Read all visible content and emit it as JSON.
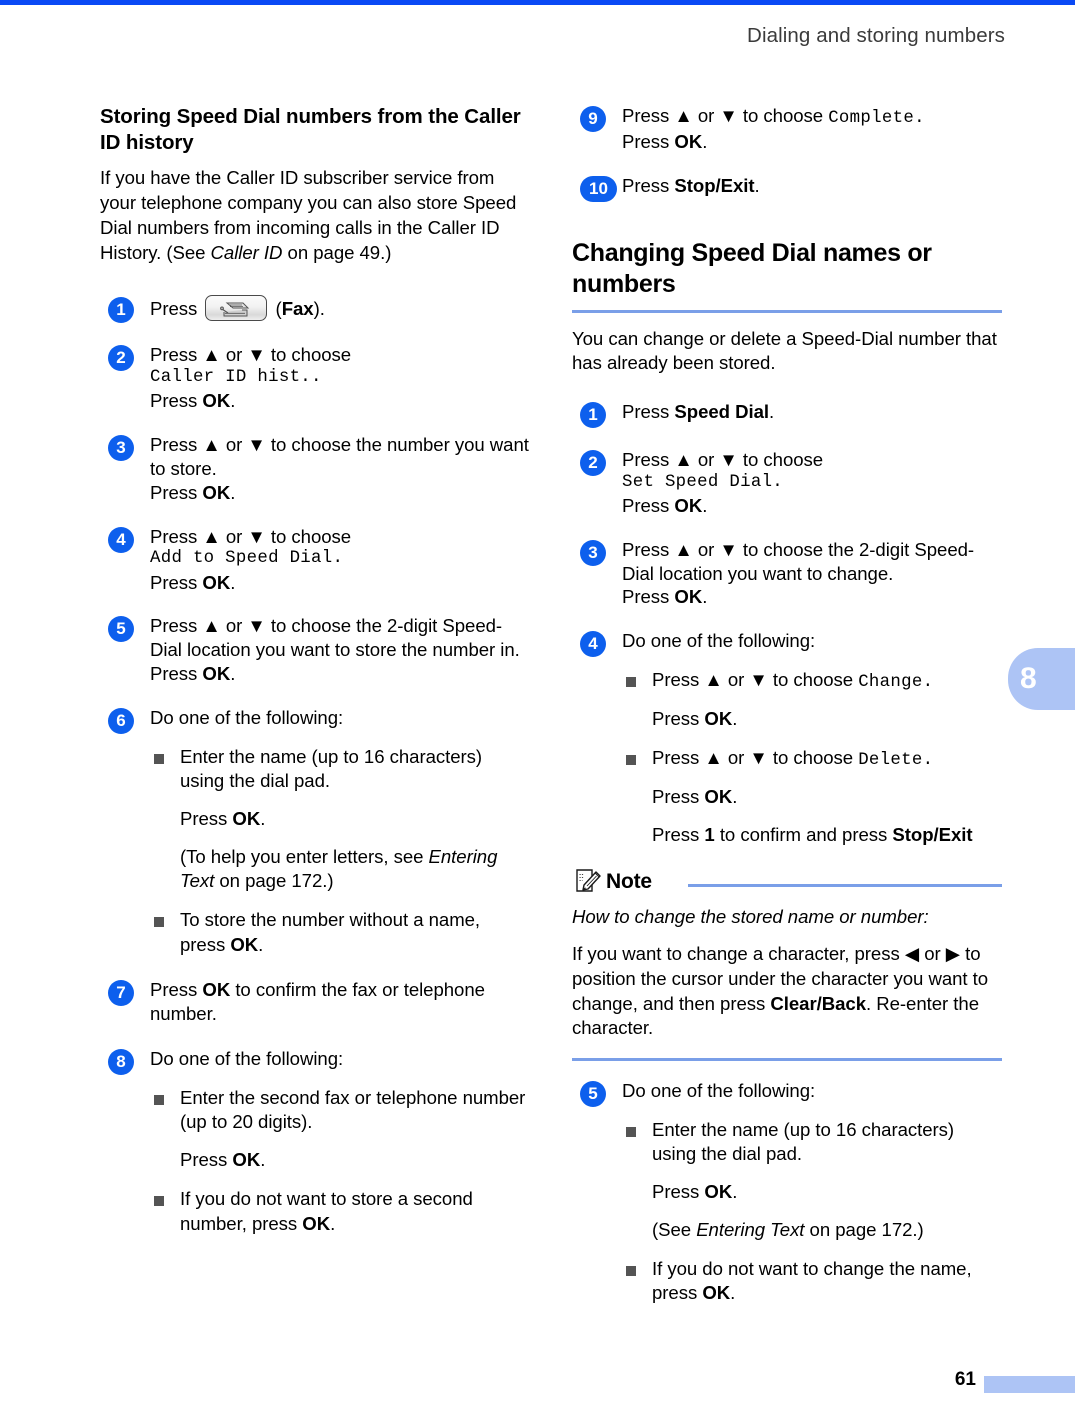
{
  "page": {
    "header_title": "Dialing and storing numbers",
    "chapter_tab": "8",
    "page_number": "61"
  },
  "left_column": {
    "heading": "Storing Speed Dial numbers from the Caller ID history",
    "intro_a": "If you have the Caller ID subscriber service from your telephone company you can also store Speed Dial numbers from incoming calls in the Caller ID History. (See ",
    "intro_italic": "Caller ID",
    "intro_b": " on page 49.)",
    "steps": [
      {
        "num": "1",
        "press": "Press",
        "icon_name": "fax-key-icon",
        "key_label": "Fax",
        "suffix": ")."
      },
      {
        "num": "2",
        "line1": "Press ▲ or ▼ to choose",
        "lcd": "Caller ID hist..",
        "line3_pre": "Press ",
        "line3_key": "OK",
        "line3_post": "."
      },
      {
        "num": "3",
        "line1": "Press ▲ or ▼ to choose the number you want to store.",
        "line3_pre": "Press ",
        "line3_key": "OK",
        "line3_post": "."
      },
      {
        "num": "4",
        "line1": "Press ▲ or ▼ to choose",
        "lcd": "Add to Speed Dial.",
        "line3_pre": "Press ",
        "line3_key": "OK",
        "line3_post": "."
      },
      {
        "num": "5",
        "line1": "Press ▲ or ▼ to choose the 2-digit Speed-Dial location you want to store the number in.",
        "line3_pre": "Press ",
        "line3_key": "OK",
        "line3_post": "."
      },
      {
        "num": "6",
        "line1": "Do one of the following:",
        "bullets": [
          {
            "text": "Enter the name (up to 16 characters) using the dial pad.",
            "follow": [
              {
                "pre": "Press ",
                "key": "OK",
                "post": "."
              },
              {
                "pre": "(To help you enter letters, see ",
                "italic": "Entering Text",
                "post": " on page 172.)"
              }
            ]
          },
          {
            "pre": "To store the number without a name, press ",
            "key": "OK",
            "post": "."
          }
        ]
      },
      {
        "num": "7",
        "pre": "Press ",
        "key": "OK",
        "post": " to confirm the fax or telephone number."
      },
      {
        "num": "8",
        "line1": "Do one of the following:",
        "bullets": [
          {
            "text": "Enter the second fax or telephone number (up to 20 digits).",
            "follow": [
              {
                "pre": "Press ",
                "key": "OK",
                "post": "."
              }
            ]
          },
          {
            "pre": "If you do not want to store a second number, press ",
            "key": "OK",
            "post": "."
          }
        ]
      }
    ]
  },
  "right_column": {
    "step9": {
      "num": "9",
      "line1_pre": "Press ▲ or ▼ to  choose ",
      "lcd": "Complete.",
      "line2_pre": "Press ",
      "line2_key": "OK",
      "line2_post": "."
    },
    "step10": {
      "num": "10",
      "pre": "Press ",
      "key": "Stop/Exit",
      "post": "."
    },
    "heading": "Changing Speed Dial names or numbers",
    "intro": "You can change or delete a Speed-Dial number that has already been stored.",
    "steps": [
      {
        "num": "1",
        "pre": "Press ",
        "key": "Speed Dial",
        "post": "."
      },
      {
        "num": "2",
        "line1": "Press ▲ or ▼ to choose",
        "lcd": "Set Speed Dial.",
        "line3_pre": "Press ",
        "line3_key": "OK",
        "line3_post": "."
      },
      {
        "num": "3",
        "line1": "Press ▲ or ▼ to choose the 2-digit Speed-Dial location you want to change.",
        "line3_pre": "Press ",
        "line3_key": "OK",
        "line3_post": "."
      },
      {
        "num": "4",
        "line1": "Do one of the following:",
        "bullets": [
          {
            "pre": "Press ▲ or ▼ to choose ",
            "lcd": "Change.",
            "follow": [
              {
                "pre": "Press ",
                "key": "OK",
                "post": "."
              }
            ]
          },
          {
            "pre": "Press ▲ or ▼ to choose ",
            "lcd": "Delete.",
            "follow": [
              {
                "pre": "Press ",
                "key": "OK",
                "post": "."
              },
              {
                "pre": "Press ",
                "key_plain": "1",
                "mid": " to confirm and press ",
                "key2": "Stop/Exit"
              }
            ]
          }
        ]
      }
    ],
    "note": {
      "icon_name": "note-pencil-icon",
      "title": "Note",
      "line1": "How to change the stored name or number:",
      "line2_a": "If you want to change a character, press ◀ or ▶ to position the cursor under the character you want to change, and then press ",
      "line2_key": "Clear/Back",
      "line2_b": ". Re-enter the character."
    },
    "step5": {
      "num": "5",
      "line1": "Do one of the following:",
      "bullets": [
        {
          "text": "Enter the name (up to 16 characters) using the dial pad.",
          "follow": [
            {
              "pre": "Press ",
              "key": "OK",
              "post": "."
            },
            {
              "pre": "(See ",
              "italic": "Entering Text",
              "post": " on page 172.)"
            }
          ]
        },
        {
          "pre": "If you do not want to change the name, press ",
          "key": "OK",
          "post": "."
        }
      ]
    }
  },
  "colors": {
    "accent_blue": "#0a49f5",
    "step_circle": "#0d5fed",
    "rule_blue": "#7a9fe8",
    "tab_blue": "#adc4f5"
  }
}
